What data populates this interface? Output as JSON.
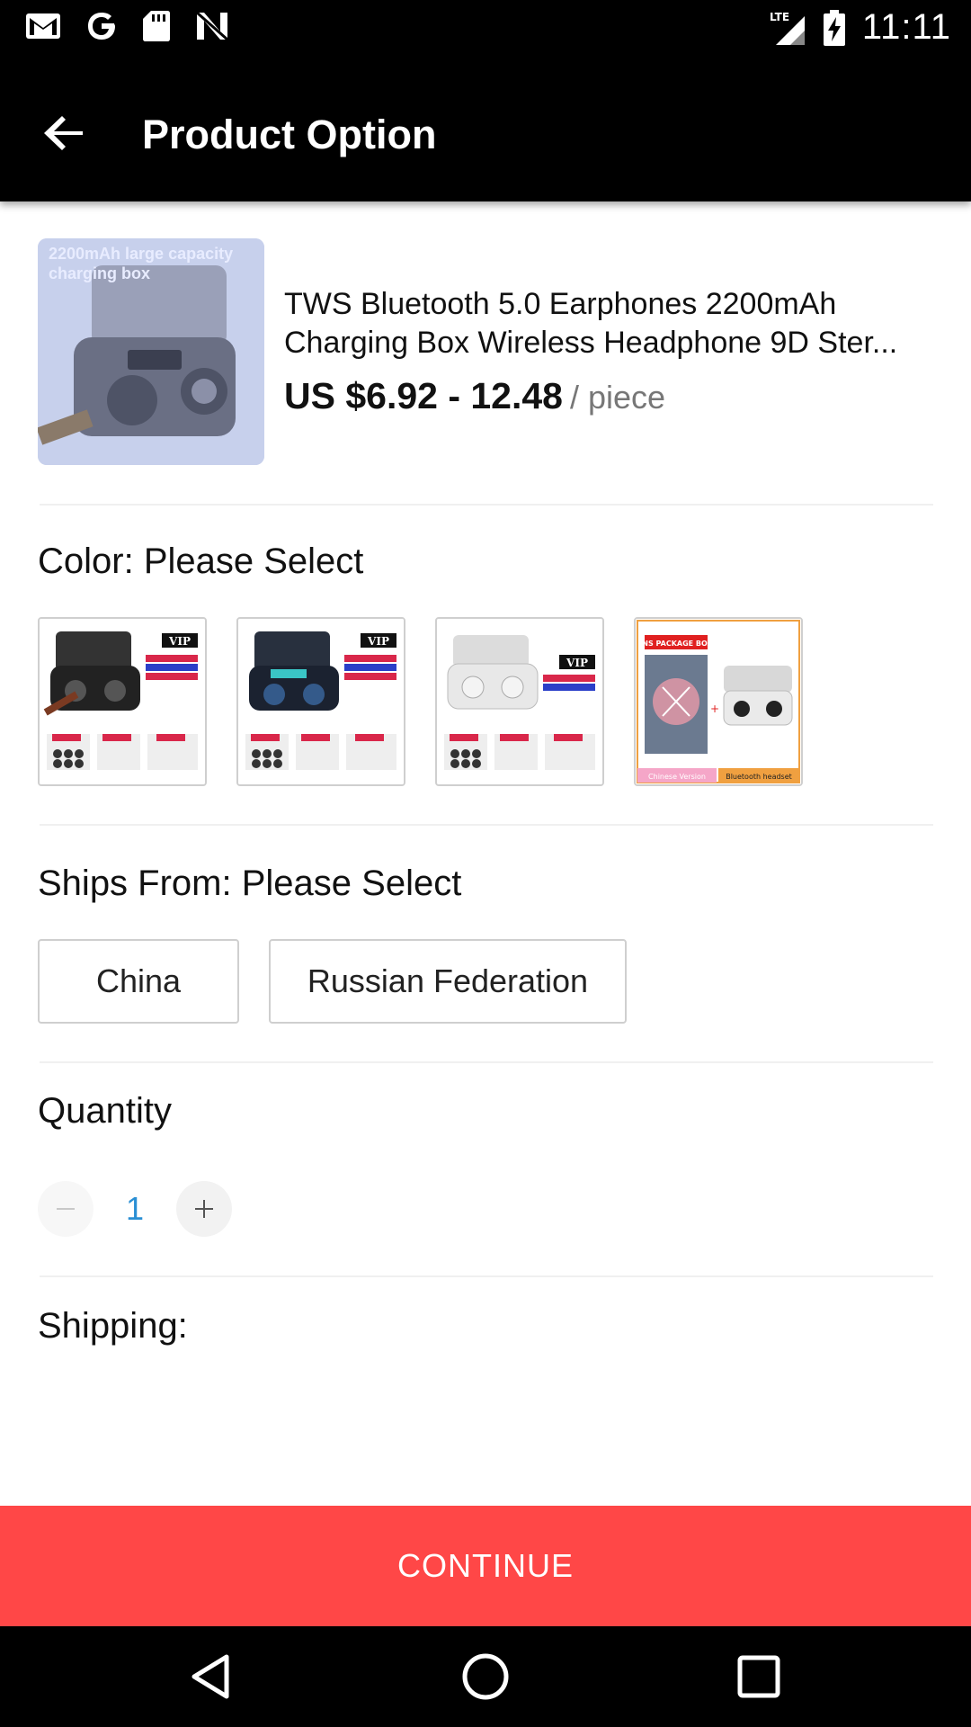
{
  "status_bar": {
    "time": "11:11",
    "network": "LTE",
    "left_icons": [
      "gmail-icon",
      "google-icon",
      "sd-card-icon",
      "n-logo-icon"
    ],
    "right_icons": [
      "signal-icon",
      "battery-charging-icon"
    ]
  },
  "app_bar": {
    "title": "Product Option",
    "back_icon": "arrow-back-icon"
  },
  "product": {
    "thumbnail_caption": "2200mAh large capacity charging box",
    "name_line1": "TWS Bluetooth 5.0 Earphones 2200mAh",
    "name_line2": "Charging Box Wireless Headphone 9D Ster...",
    "price": "US $6.92 - 12.48",
    "unit": "/ piece"
  },
  "color": {
    "label": "Color: Please Select",
    "options": [
      {
        "name": "black-earphones-vip",
        "badge": "VIP"
      },
      {
        "name": "blue-earphones-vip",
        "badge": "VIP"
      },
      {
        "name": "white-earphones-vip",
        "badge": "VIP"
      },
      {
        "name": "bluetooth-headset-package",
        "badge": "INS PACKAGE BOX",
        "caption_left": "Chinese Version",
        "caption_right": "Bluetooth headset"
      }
    ]
  },
  "ships_from": {
    "label": "Ships From: Please Select",
    "options": [
      "China",
      "Russian Federation"
    ]
  },
  "quantity": {
    "label": "Quantity",
    "value": "1",
    "minus_icon": "minus-icon",
    "plus_icon": "plus-icon"
  },
  "shipping": {
    "label": "Shipping:"
  },
  "continue_button": {
    "label": "CONTINUE",
    "color": "#ff4747"
  },
  "nav_bar": {
    "icons": [
      "nav-back-icon",
      "nav-home-icon",
      "nav-recents-icon"
    ]
  }
}
